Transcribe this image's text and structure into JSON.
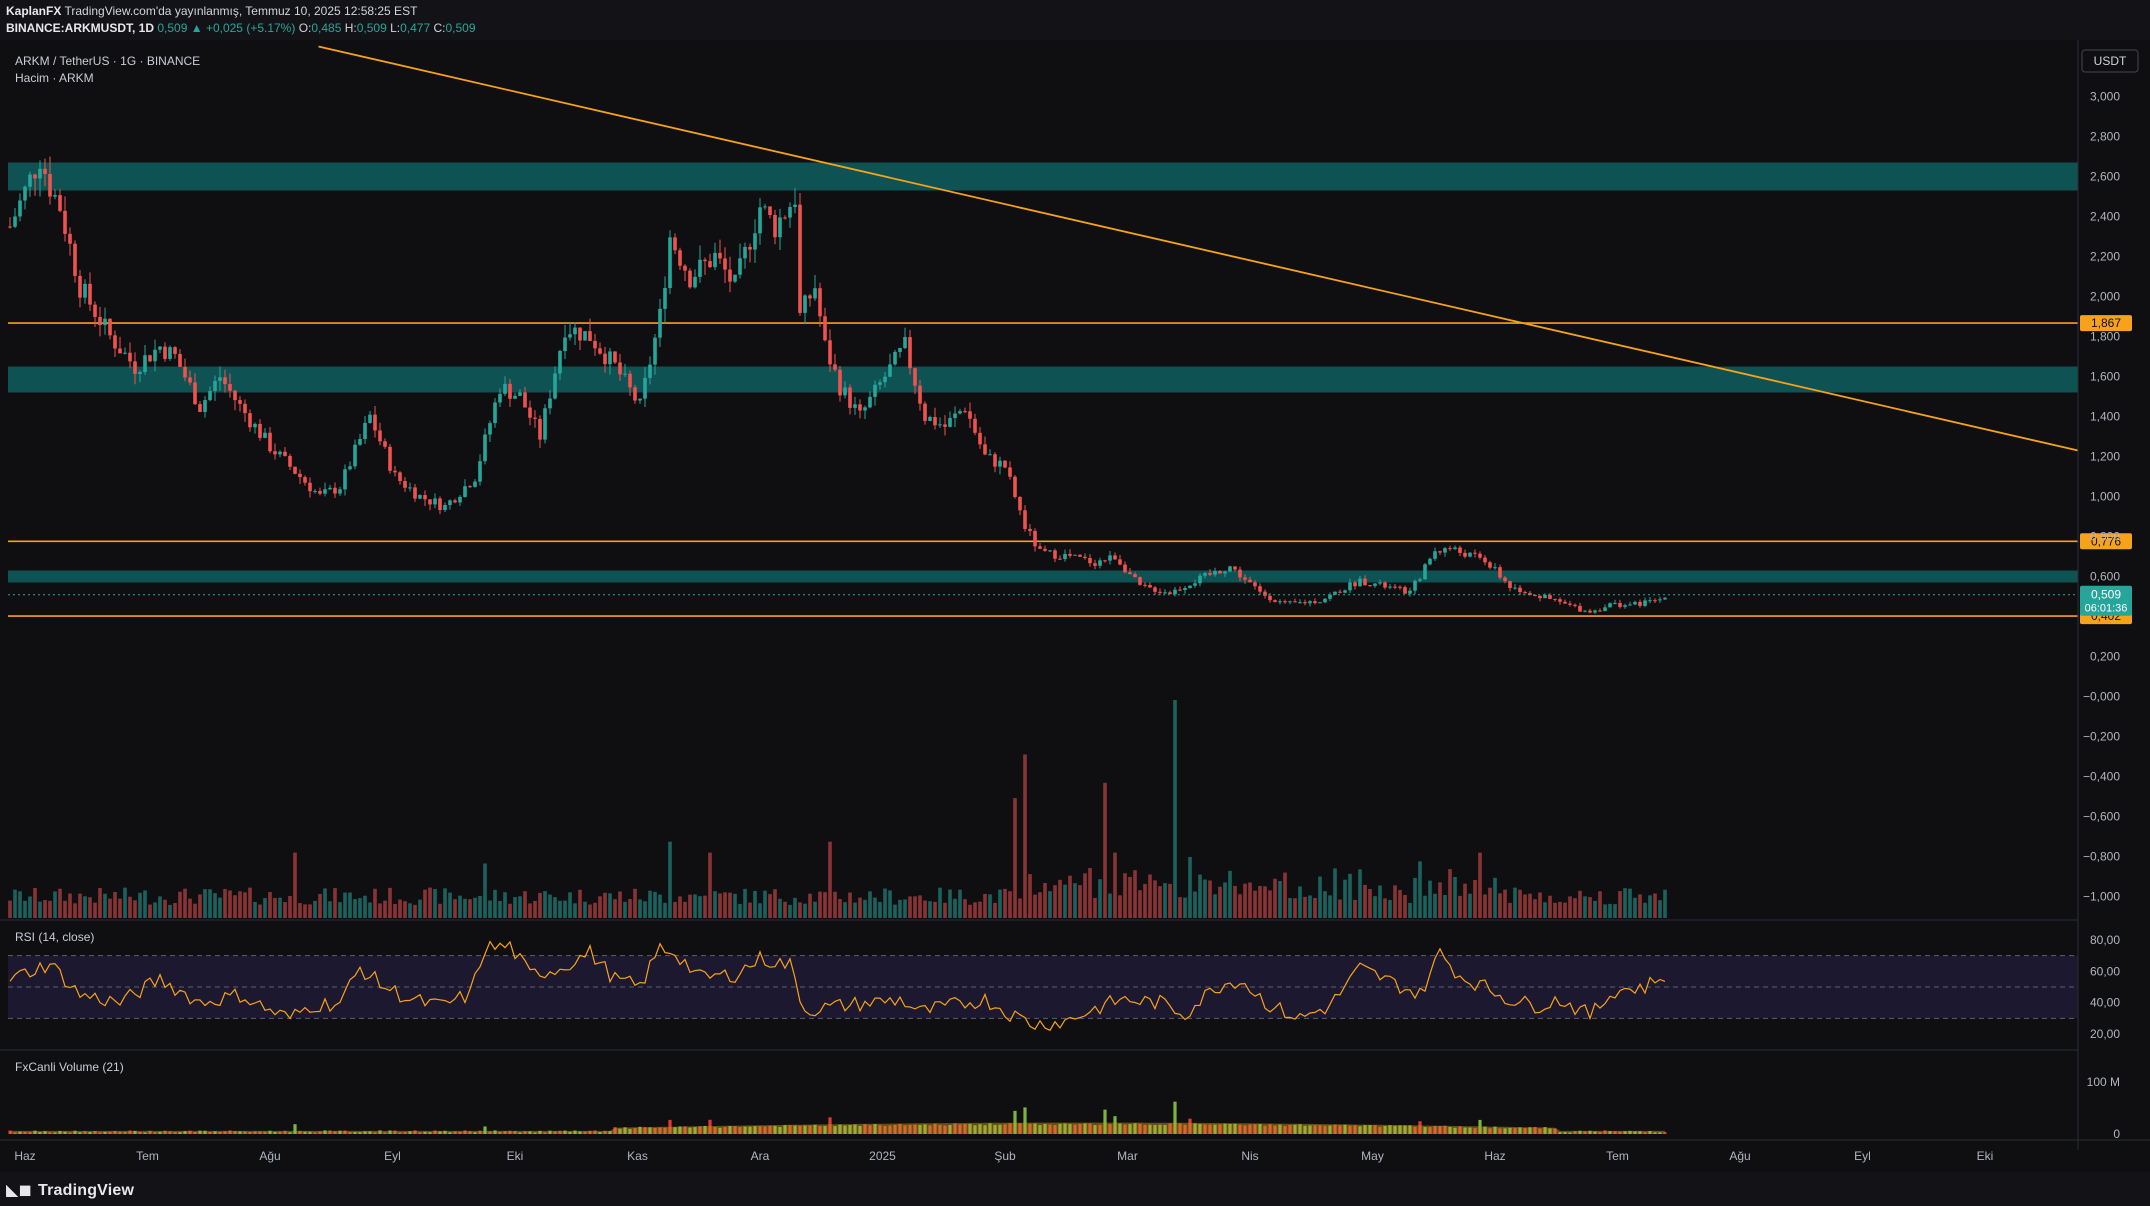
{
  "header": {
    "publisher": "KaplanFX",
    "published_text": "TradingView.com'da yayınlanmış, Temmuz 10, 2025 12:58:25 EST",
    "symbol_line": "BINANCE:ARKMUSDT, 1D",
    "last": "0,509",
    "change": "▲ +0,025 (+5.17%)",
    "o_label": "O:",
    "o": "0,485",
    "h_label": "H:",
    "h": "0,509",
    "l_label": "L:",
    "l": "0,477",
    "c_label": "C:",
    "c": "0,509"
  },
  "legend": {
    "title": "ARKM / TetherUS · 1G · BINANCE",
    "volume": "Hacim · ARKM",
    "rsi": "RSI (14, close)",
    "fx": "FxCanli Volume (21)"
  },
  "currency": "USDT",
  "footer": {
    "brand": "TradingView"
  },
  "colors": {
    "bull": "#26a69a",
    "bear": "#ef5350",
    "level": "#f7a21b",
    "zone": "#0f5a5c",
    "rsi_line": "#f7a21b",
    "rsi_band": "#1e1a33"
  },
  "chart_data": [
    {
      "type": "candlestick",
      "title": "ARKM / TetherUS · 1G · BINANCE",
      "x_ticks": [
        "Haz",
        "Tem",
        "Ağu",
        "Eyl",
        "Eki",
        "Kas",
        "Ara",
        "2025",
        "Şub",
        "Mar",
        "Nis",
        "May",
        "Haz",
        "Tem",
        "Ağu",
        "Eyl",
        "Eki"
      ],
      "y_ticks": [
        "3,000",
        "2,800",
        "2,600",
        "2,400",
        "2,200",
        "2,000",
        "1,800",
        "1,600",
        "1,400",
        "1,200",
        "1,000",
        "0,800",
        "0,600",
        "0,200",
        "−0,000",
        "−0,200",
        "−0,400",
        "−0,600",
        "−0,800",
        "−1,000"
      ],
      "ylim": [
        -1.05,
        3.15
      ],
      "close_anchors": [
        [
          0,
          2.35
        ],
        [
          6,
          2.7
        ],
        [
          8,
          2.55
        ],
        [
          10,
          2.45
        ],
        [
          14,
          2.05
        ],
        [
          20,
          1.8
        ],
        [
          25,
          1.65
        ],
        [
          30,
          1.75
        ],
        [
          33,
          1.7
        ],
        [
          38,
          1.45
        ],
        [
          42,
          1.6
        ],
        [
          46,
          1.45
        ],
        [
          52,
          1.25
        ],
        [
          58,
          1.1
        ],
        [
          62,
          1.0
        ],
        [
          66,
          1.05
        ],
        [
          72,
          1.4
        ],
        [
          77,
          1.1
        ],
        [
          82,
          1.0
        ],
        [
          87,
          0.95
        ],
        [
          93,
          1.1
        ],
        [
          98,
          1.55
        ],
        [
          102,
          1.5
        ],
        [
          106,
          1.3
        ],
        [
          111,
          1.85
        ],
        [
          116,
          1.8
        ],
        [
          121,
          1.65
        ],
        [
          126,
          1.45
        ],
        [
          130,
          1.9
        ],
        [
          132,
          2.3
        ],
        [
          136,
          2.1
        ],
        [
          141,
          2.2
        ],
        [
          145,
          2.05
        ],
        [
          150,
          2.45
        ],
        [
          153,
          2.35
        ],
        [
          157,
          2.5
        ],
        [
          158,
          1.9
        ],
        [
          161,
          2.05
        ],
        [
          163,
          1.75
        ],
        [
          166,
          1.55
        ],
        [
          170,
          1.4
        ],
        [
          175,
          1.6
        ],
        [
          179,
          1.75
        ],
        [
          183,
          1.4
        ],
        [
          187,
          1.35
        ],
        [
          191,
          1.45
        ],
        [
          195,
          1.2
        ],
        [
          199,
          1.15
        ],
        [
          203,
          0.85
        ],
        [
          206,
          0.72
        ],
        [
          212,
          0.7
        ],
        [
          217,
          0.67
        ],
        [
          221,
          0.7
        ],
        [
          226,
          0.55
        ],
        [
          232,
          0.52
        ],
        [
          239,
          0.6
        ],
        [
          244,
          0.65
        ],
        [
          250,
          0.52
        ],
        [
          255,
          0.46
        ],
        [
          262,
          0.48
        ],
        [
          270,
          0.58
        ],
        [
          275,
          0.55
        ],
        [
          280,
          0.52
        ],
        [
          285,
          0.73
        ],
        [
          288,
          0.74
        ],
        [
          295,
          0.68
        ],
        [
          300,
          0.55
        ],
        [
          306,
          0.5
        ],
        [
          310,
          0.47
        ],
        [
          316,
          0.42
        ],
        [
          320,
          0.46
        ],
        [
          325,
          0.46
        ],
        [
          330,
          0.485
        ],
        [
          331,
          0.509
        ]
      ],
      "volume_peak_bars": [
        [
          57,
          0.3
        ],
        [
          95,
          0.25
        ],
        [
          132,
          0.35
        ],
        [
          140,
          0.3
        ],
        [
          164,
          0.35
        ],
        [
          201,
          0.55
        ],
        [
          203,
          0.75
        ],
        [
          219,
          0.62
        ],
        [
          221,
          0.3
        ],
        [
          233,
          1.0
        ],
        [
          236,
          0.28
        ],
        [
          282,
          0.26
        ],
        [
          294,
          0.3
        ]
      ],
      "horizontal_levels": [
        "1,867",
        "0,776",
        "0,402"
      ],
      "zones_usdt": [
        [
          2.53,
          2.67
        ],
        [
          1.52,
          1.65
        ],
        [
          0.57,
          0.63
        ]
      ],
      "trendline_usdt": [
        [
          0.15,
          3.25
        ],
        [
          1.0,
          1.23
        ]
      ],
      "last_price_label": "0,509",
      "countdown": "06:01:36"
    },
    {
      "type": "line",
      "title": "RSI (14, close)",
      "y_ticks": [
        "80,00",
        "60,00",
        "40,00",
        "20,00"
      ],
      "ylim": [
        15,
        85
      ],
      "band": [
        30,
        70
      ],
      "midline": 50,
      "anchors": [
        [
          0,
          55
        ],
        [
          8,
          65
        ],
        [
          14,
          45
        ],
        [
          22,
          40
        ],
        [
          30,
          55
        ],
        [
          38,
          40
        ],
        [
          46,
          45
        ],
        [
          52,
          35
        ],
        [
          56,
          30
        ],
        [
          60,
          38
        ],
        [
          66,
          40
        ],
        [
          70,
          62
        ],
        [
          75,
          50
        ],
        [
          80,
          42
        ],
        [
          86,
          38
        ],
        [
          92,
          45
        ],
        [
          95,
          75
        ],
        [
          100,
          76
        ],
        [
          104,
          58
        ],
        [
          110,
          62
        ],
        [
          116,
          72
        ],
        [
          121,
          55
        ],
        [
          126,
          50
        ],
        [
          130,
          75
        ],
        [
          133,
          72
        ],
        [
          138,
          56
        ],
        [
          145,
          58
        ],
        [
          150,
          68
        ],
        [
          156,
          64
        ],
        [
          159,
          35
        ],
        [
          166,
          38
        ],
        [
          172,
          40
        ],
        [
          178,
          42
        ],
        [
          182,
          34
        ],
        [
          188,
          38
        ],
        [
          195,
          42
        ],
        [
          200,
          33
        ],
        [
          205,
          26
        ],
        [
          211,
          28
        ],
        [
          217,
          36
        ],
        [
          222,
          42
        ],
        [
          230,
          40
        ],
        [
          235,
          33
        ],
        [
          241,
          50
        ],
        [
          246,
          55
        ],
        [
          252,
          38
        ],
        [
          258,
          30
        ],
        [
          264,
          38
        ],
        [
          270,
          62
        ],
        [
          275,
          55
        ],
        [
          282,
          45
        ],
        [
          286,
          72
        ],
        [
          290,
          57
        ],
        [
          295,
          50
        ],
        [
          300,
          42
        ],
        [
          305,
          38
        ],
        [
          310,
          42
        ],
        [
          316,
          32
        ],
        [
          321,
          48
        ],
        [
          327,
          50
        ],
        [
          331,
          58
        ]
      ]
    },
    {
      "type": "bar",
      "title": "FxCanli Volume (21)",
      "y_ticks": [
        "100 M",
        "0"
      ],
      "ylim": [
        0,
        115
      ]
    }
  ]
}
